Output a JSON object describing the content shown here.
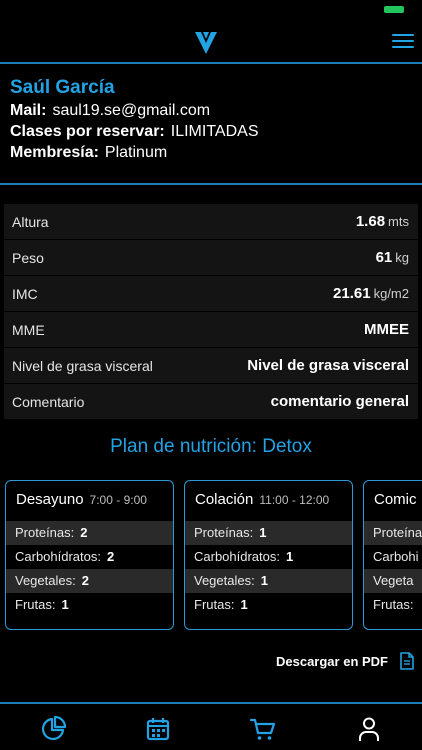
{
  "status": {
    "battery_color": "#22c55e"
  },
  "header": {
    "logo_icon": "v-logo-icon",
    "menu_icon": "hamburger-menu-icon"
  },
  "profile": {
    "name": "Saúl García",
    "mail_label": "Mail:",
    "mail_value": "saul19.se@gmail.com",
    "classes_label": "Clases por reservar:",
    "classes_value": "ILIMITADAS",
    "membership_label": "Membresía:",
    "membership_value": "Platinum"
  },
  "stats": [
    {
      "label": "Altura",
      "value": "1.68",
      "unit": "mts"
    },
    {
      "label": "Peso",
      "value": "61",
      "unit": "kg"
    },
    {
      "label": "IMC",
      "value": "21.61",
      "unit": "kg/m2"
    },
    {
      "label": "MME",
      "value": "MMEE",
      "unit": ""
    },
    {
      "label": "Nivel de grasa visceral",
      "value": "Nivel de grasa visceral",
      "unit": ""
    },
    {
      "label": "Comentario",
      "value": "comentario general",
      "unit": ""
    }
  ],
  "plan": {
    "title": "Plan de nutrición: Detox",
    "meals": [
      {
        "name": "Desayuno",
        "time": "7:00 - 9:00",
        "items": [
          {
            "label": "Proteínas:",
            "value": "2"
          },
          {
            "label": "Carbohídratos:",
            "value": "2"
          },
          {
            "label": "Vegetales:",
            "value": "2"
          },
          {
            "label": "Frutas:",
            "value": "1"
          }
        ]
      },
      {
        "name": "Colación",
        "time": "11:00 - 12:00",
        "items": [
          {
            "label": "Proteínas:",
            "value": "1"
          },
          {
            "label": "Carbohídratos:",
            "value": "1"
          },
          {
            "label": "Vegetales:",
            "value": "1"
          },
          {
            "label": "Frutas:",
            "value": "1"
          }
        ]
      },
      {
        "name": "Comic",
        "time": "",
        "items": [
          {
            "label": "Proteína",
            "value": ""
          },
          {
            "label": "Carbohi",
            "value": ""
          },
          {
            "label": "Vegeta",
            "value": ""
          },
          {
            "label": "Frutas:",
            "value": ""
          }
        ]
      }
    ]
  },
  "download": {
    "label": "Descargar en PDF",
    "icon": "pdf-document-icon"
  },
  "tabbar": {
    "accent": "#22a3e4",
    "tabs": [
      {
        "icon": "pie-chart-icon"
      },
      {
        "icon": "calendar-icon"
      },
      {
        "icon": "cart-icon"
      },
      {
        "icon": "person-icon"
      }
    ]
  }
}
